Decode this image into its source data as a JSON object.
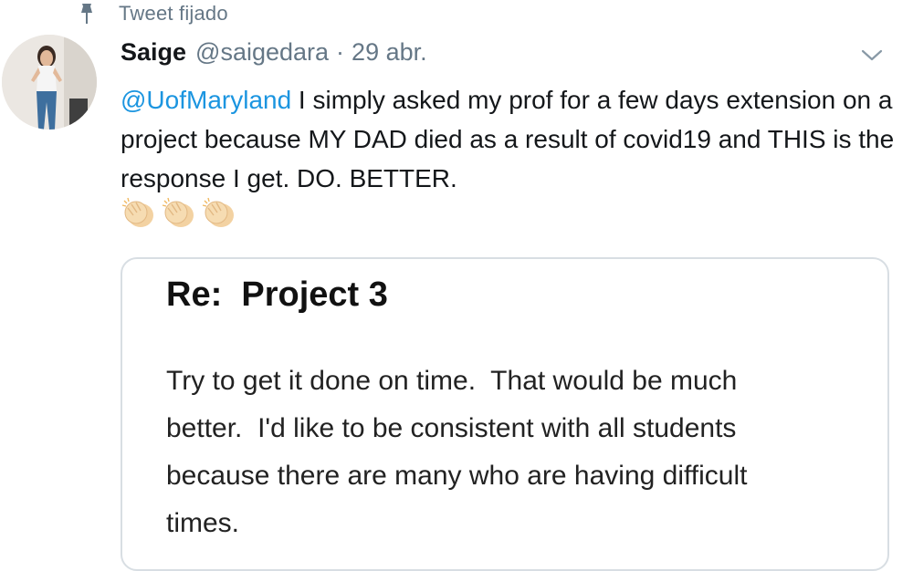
{
  "pinned": {
    "label": "Tweet fijado",
    "icon": "pin-icon"
  },
  "tweet": {
    "display_name": "Saige",
    "handle": "@saigedara",
    "separator": "·",
    "date": "29 abr.",
    "mention": "@UofMaryland",
    "text": " I simply asked my prof for a few days extension on a project because MY DAD died as a result of covid19 and THIS is the response I get. DO. BETTER.",
    "emojis": [
      "clapping-hands-icon",
      "clapping-hands-icon",
      "clapping-hands-icon"
    ],
    "menu_icon": "chevron-down-icon"
  },
  "card": {
    "title": "Re:  Project 3",
    "body_lines": [
      "Try to get it done on time.  That would be much",
      "better.  I'd like to be consistent with all students",
      "because there are many who are having difficult",
      "times."
    ]
  },
  "colors": {
    "link": "#1b95e0",
    "muted": "#657786",
    "text": "#14171a",
    "card_border": "#d8dee3",
    "emoji_skin": "#f3d2a2"
  }
}
